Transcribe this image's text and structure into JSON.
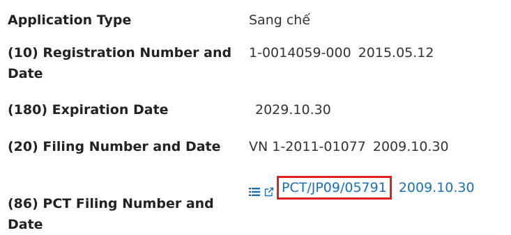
{
  "rows": [
    {
      "label": "Application Type",
      "value": "Sang chế"
    },
    {
      "label_line1": "(10) Registration Number and",
      "label_line2": "Date",
      "number": "1-0014059-000",
      "date": "2015.05.12"
    },
    {
      "label": "(180) Expiration Date",
      "value": "2029.10.30"
    },
    {
      "label": "(20) Filing Number and Date",
      "number": "VN 1-2011-01077",
      "date": "2009.10.30"
    },
    {
      "label_line1": "(86) PCT Filing Number and",
      "label_line2": "Date",
      "pct_number": "PCT/JP09/05791",
      "date": "2009.10.30"
    }
  ],
  "icons": {
    "list": "list-icon",
    "external": "external-link-icon"
  },
  "colors": {
    "link": "#1a6fb5",
    "highlight_box": "#e0201d",
    "label": "#222222"
  }
}
